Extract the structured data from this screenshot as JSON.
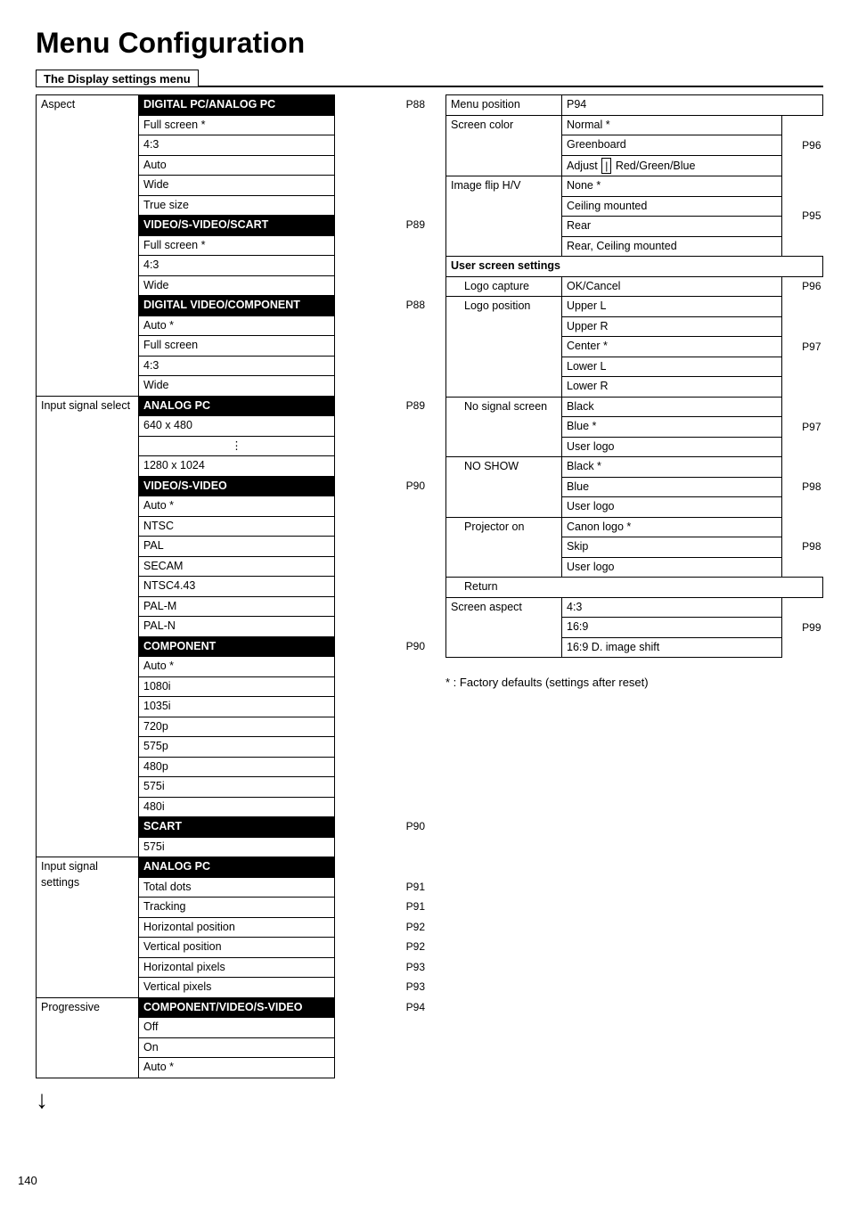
{
  "title": "Menu Configuration",
  "subtitle": "The Display settings menu",
  "left": {
    "sections": [
      {
        "label": "Aspect",
        "entries": [
          {
            "highlight": true,
            "text": "DIGITAL PC/ANALOG PC",
            "page": "P88"
          },
          {
            "text": "Full screen *"
          },
          {
            "text": "4:3"
          },
          {
            "text": "Auto"
          },
          {
            "text": "Wide"
          },
          {
            "text": "True size"
          },
          {
            "highlight": true,
            "text": "VIDEO/S-VIDEO/SCART",
            "page": "P89"
          },
          {
            "text": "Full screen *"
          },
          {
            "text": "4:3"
          },
          {
            "text": "Wide"
          },
          {
            "highlight": true,
            "text": "DIGITAL VIDEO/COMPONENT",
            "page": "P88"
          },
          {
            "text": "Auto *"
          },
          {
            "text": "Full screen"
          },
          {
            "text": "4:3"
          },
          {
            "text": "Wide"
          }
        ]
      },
      {
        "label": "Input signal select",
        "entries": [
          {
            "highlight": true,
            "text": "ANALOG PC",
            "page": "P89"
          },
          {
            "text": "640 x 480"
          },
          {
            "text": "⋮"
          },
          {
            "text": "1280 x 1024"
          },
          {
            "highlight": true,
            "text": "VIDEO/S-VIDEO",
            "page": "P90"
          },
          {
            "text": "Auto *"
          },
          {
            "text": "NTSC"
          },
          {
            "text": "PAL"
          },
          {
            "text": "SECAM"
          },
          {
            "text": "NTSC4.43"
          },
          {
            "text": "PAL-M"
          },
          {
            "text": "PAL-N"
          },
          {
            "highlight": true,
            "text": "COMPONENT",
            "page": "P90"
          },
          {
            "text": "Auto *"
          },
          {
            "text": "1080i"
          },
          {
            "text": "1035i"
          },
          {
            "text": "720p"
          },
          {
            "text": "575p"
          },
          {
            "text": "480p"
          },
          {
            "text": "575i"
          },
          {
            "text": "480i"
          },
          {
            "highlight": true,
            "text": "SCART",
            "page": "P90"
          },
          {
            "text": "575i"
          }
        ]
      },
      {
        "label": "Input signal settings",
        "entries": [
          {
            "highlight": true,
            "text": "ANALOG PC"
          },
          {
            "text": "Total dots",
            "page": "P91"
          },
          {
            "text": "Tracking",
            "page": "P91"
          },
          {
            "text": "Horizontal position",
            "page": "P92"
          },
          {
            "text": "Vertical position",
            "page": "P92"
          },
          {
            "text": "Horizontal pixels",
            "page": "P93"
          },
          {
            "text": "Vertical pixels",
            "page": "P93"
          }
        ]
      },
      {
        "label": "Progressive",
        "entries": [
          {
            "highlight": true,
            "text": "COMPONENT/VIDEO/S-VIDEO",
            "page": "P94"
          },
          {
            "text": "Off"
          },
          {
            "text": "On"
          },
          {
            "text": "Auto *"
          }
        ],
        "hasArrow": true
      }
    ]
  },
  "right": {
    "menuPosition": {
      "label": "Menu position",
      "page": "P94"
    },
    "screenColor": {
      "label": "Screen color",
      "page": "P96",
      "options": [
        "Normal *",
        "Greenboard",
        "Adjust | Red/Green/Blue"
      ]
    },
    "imageFlip": {
      "label": "Image flip H/V",
      "page": "P95",
      "options": [
        "None *",
        "Ceiling mounted",
        "Rear",
        "Rear, Ceiling mounted"
      ]
    },
    "userScreenSettings": {
      "label": "User screen settings",
      "items": [
        {
          "label": "Logo capture",
          "option": "OK/Cancel",
          "page": "P96"
        },
        {
          "label": "Logo position",
          "page": "P97",
          "options": [
            "Upper L",
            "Upper R",
            "Center *",
            "Lower L",
            "Lower R"
          ]
        },
        {
          "label": "No signal screen",
          "page": "P97",
          "options": [
            "Black",
            "Blue *",
            "User logo"
          ]
        },
        {
          "label": "NO SHOW",
          "page": "P98",
          "options": [
            "Black *",
            "Blue",
            "User logo"
          ]
        },
        {
          "label": "Projector on",
          "page": "P98",
          "options": [
            "Canon logo *",
            "Skip",
            "User logo"
          ]
        },
        {
          "label": "Return",
          "isReturn": true
        }
      ]
    },
    "screenAspect": {
      "label": "Screen aspect",
      "page": "P99",
      "options": [
        "4:3",
        "16:9",
        "16:9 D. image shift"
      ]
    }
  },
  "footer": {
    "note": "* : Factory defaults (settings after reset)",
    "pageNumber": "140"
  }
}
